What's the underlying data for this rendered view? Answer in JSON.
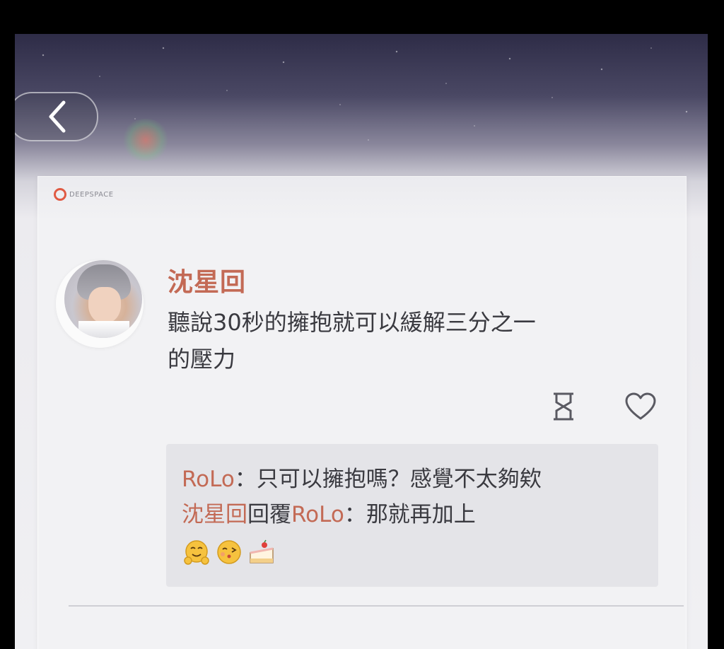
{
  "brand": {
    "name": "DEEPSPACE"
  },
  "post": {
    "author": "沈星回",
    "text_line1": "聽說30秒的擁抱就可以緩解三分之一",
    "text_line2": "的壓力"
  },
  "actions": {
    "hourglass_icon": "hourglass-icon",
    "heart_icon": "heart-icon"
  },
  "comments": [
    {
      "author": "RoLo",
      "separator": "：",
      "text": "只可以擁抱嗎？感覺不太夠欸"
    },
    {
      "author": "沈星回",
      "reply_word": "回覆",
      "reply_to": "RoLo",
      "separator": "：",
      "text": "那就再加上"
    }
  ],
  "emojis": [
    "hugging-face-emoji",
    "kissing-face-emoji",
    "cake-emoji"
  ],
  "colors": {
    "accent": "#c36a55",
    "text": "#3a3a40",
    "comment_bg": "#e4e4e8"
  }
}
